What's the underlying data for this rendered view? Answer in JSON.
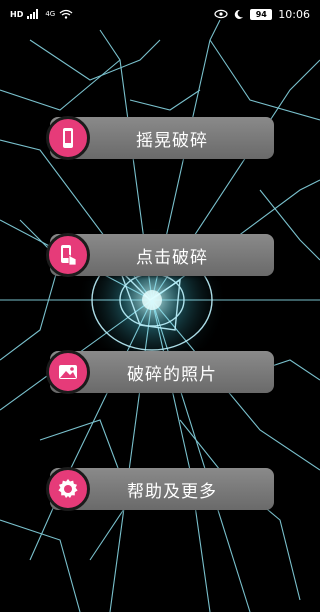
{
  "status_bar": {
    "carrier": "HD",
    "network": "4G",
    "battery": "94",
    "time": "10:06",
    "icons": [
      "hd-icon",
      "signal-icon",
      "wifi-icon",
      "eye-icon",
      "moon-icon",
      "battery-icon"
    ]
  },
  "menu": {
    "items": [
      {
        "label": "摇晃破碎",
        "icon": "phone-icon"
      },
      {
        "label": "点击破碎",
        "icon": "tap-phone-icon"
      },
      {
        "label": "破碎的照片",
        "icon": "photo-icon"
      },
      {
        "label": "帮助及更多",
        "icon": "gear-icon"
      }
    ]
  },
  "colors": {
    "badge": "#e63b79",
    "button": "#787878",
    "background": "#000000",
    "crack": "#7fd6e8"
  }
}
